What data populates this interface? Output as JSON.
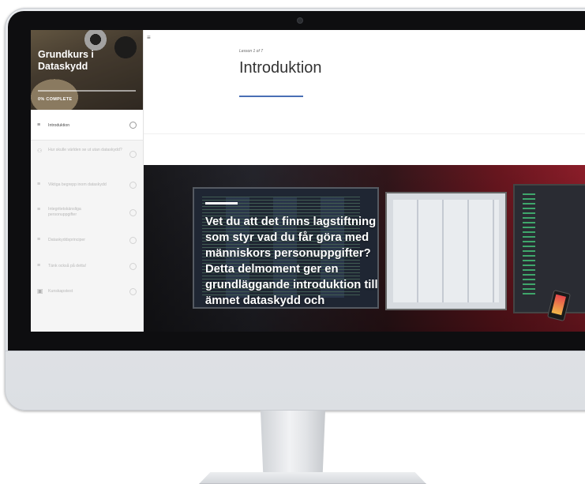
{
  "course": {
    "title": "Grundkurs i\nDataskydd",
    "progress_label": "0% COMPLETE",
    "progress_fraction": 0
  },
  "lessons": [
    {
      "label": "Introduktion",
      "icon": "lines-icon",
      "active": true
    },
    {
      "label": "Hur skulle världen se ut utan dataskydd?",
      "icon": "people-icon",
      "active": false
    },
    {
      "label": "Viktiga begrepp inom dataskydd",
      "icon": "lines-icon",
      "active": false
    },
    {
      "label": "Integritetskänsliga personuppgifter",
      "icon": "lines-icon",
      "active": false
    },
    {
      "label": "Dataskyddsprinciper",
      "icon": "lines-icon",
      "active": false
    },
    {
      "label": "Tänk också på detta!",
      "icon": "lines-icon",
      "active": false
    },
    {
      "label": "Kunskapstest",
      "icon": "quiz-icon",
      "active": false
    }
  ],
  "main": {
    "lesson_counter": "Lesson 1 of 7",
    "title": "Introduktion",
    "accent_color": "#4a6fb5",
    "hero_text": "Vet du att det finns lagstiftning\nsom styr vad du får göra med\nmänniskors personuppgifter?\nDetta delmoment ger en\ngrundläggande introduktion till\nämnet dataskydd och"
  }
}
